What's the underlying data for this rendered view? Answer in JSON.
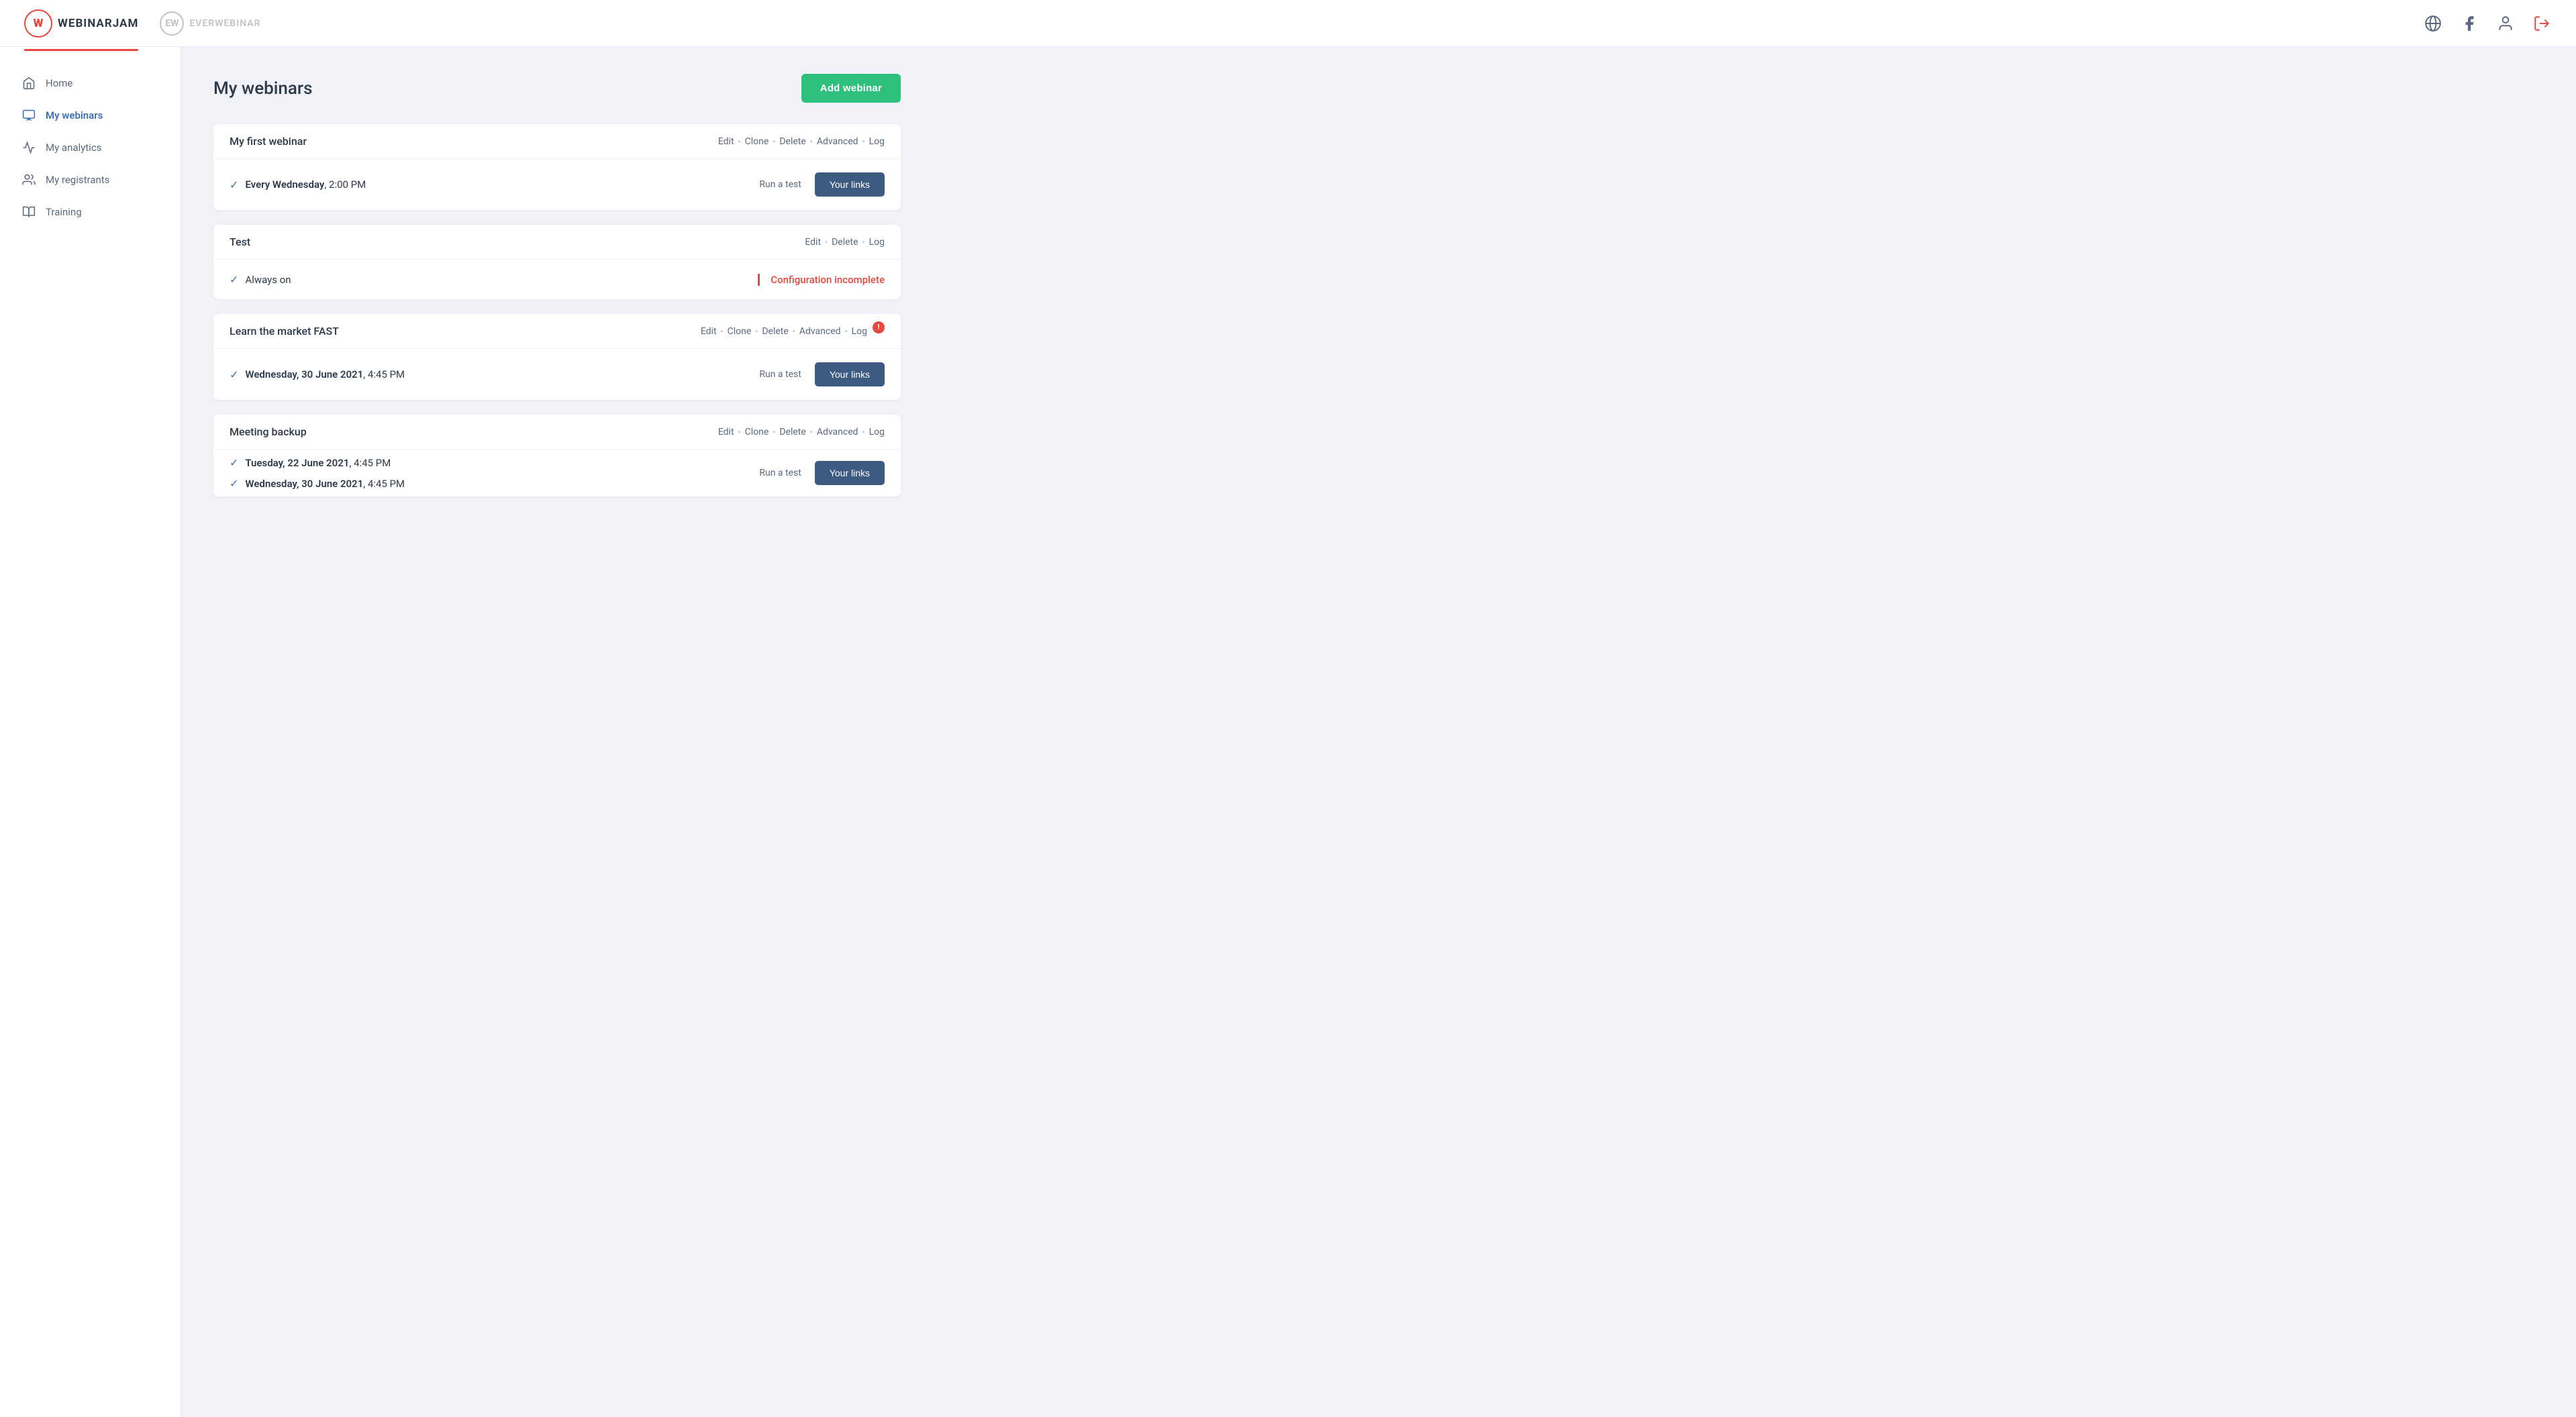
{
  "header": {
    "logo_wj_letter": "W",
    "logo_wj_text": "WEBINARJAM",
    "logo_ew_letter": "EW",
    "logo_ew_text": "EVERWEBINAR"
  },
  "sidebar": {
    "items": [
      {
        "id": "home",
        "label": "Home",
        "active": false
      },
      {
        "id": "my-webinars",
        "label": "My webinars",
        "active": true
      },
      {
        "id": "my-analytics",
        "label": "My analytics",
        "active": false
      },
      {
        "id": "my-registrants",
        "label": "My registrants",
        "active": false
      },
      {
        "id": "training",
        "label": "Training",
        "active": false
      }
    ]
  },
  "main": {
    "title": "My webinars",
    "add_button_label": "Add webinar",
    "webinars": [
      {
        "id": "webinar-1",
        "title": "My first webinar",
        "actions": [
          "Edit",
          "Clone",
          "Delete",
          "Advanced",
          "Log"
        ],
        "schedules": [
          {
            "text": "Every Wednesday",
            "suffix": ", 2:00 PM",
            "bold": true
          }
        ],
        "run_test_label": "Run a test",
        "your_links_label": "Your links",
        "show_your_links": true,
        "config_incomplete": false,
        "notification_badge": null
      },
      {
        "id": "webinar-2",
        "title": "Test",
        "actions": [
          "Edit",
          "Delete",
          "Log"
        ],
        "schedules": [
          {
            "text": "Always on",
            "suffix": "",
            "bold": false
          }
        ],
        "run_test_label": "",
        "your_links_label": "",
        "show_your_links": false,
        "config_incomplete": true,
        "config_incomplete_label": "Configuration incomplete",
        "notification_badge": null
      },
      {
        "id": "webinar-3",
        "title": "Learn the market FAST",
        "actions": [
          "Edit",
          "Clone",
          "Delete",
          "Advanced",
          "Log"
        ],
        "schedules": [
          {
            "text": "Wednesday, 30 June 2021",
            "suffix": ", 4:45 PM",
            "bold": true
          }
        ],
        "run_test_label": "Run a test",
        "your_links_label": "Your links",
        "show_your_links": true,
        "config_incomplete": false,
        "notification_badge": "!"
      },
      {
        "id": "webinar-4",
        "title": "Meeting backup",
        "actions": [
          "Edit",
          "Clone",
          "Delete",
          "Advanced",
          "Log"
        ],
        "schedules": [
          {
            "text": "Tuesday, 22 June 2021",
            "suffix": ", 4:45 PM",
            "bold": true
          },
          {
            "text": "Wednesday, 30 June 2021",
            "suffix": ", 4:45 PM",
            "bold": true
          }
        ],
        "run_test_label": "Run a test",
        "your_links_label": "Your links",
        "show_your_links": true,
        "config_incomplete": false,
        "notification_badge": null
      }
    ]
  }
}
